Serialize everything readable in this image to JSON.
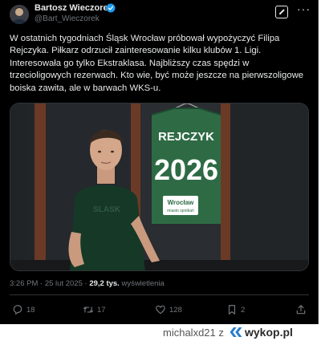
{
  "author": {
    "name": "Bartosz Wieczorek",
    "handle": "@Bart_Wieczorek"
  },
  "tweet": {
    "lines": [
      "W ostatnich tygodniach Śląsk Wrocław próbował wypożyczyć Filipa",
      "Rejczyka. Piłkarz odrzucił zainteresowanie kilku klubów 1. Ligi.",
      "Interesowała go tylko Ekstraklasa. Najbliższy czas spędzi w",
      "trzecioligowych rezerwach. Kto wie, być może jeszcze na pierwszoligowe",
      "boiska zawita, ale w barwach WKS-u."
    ]
  },
  "photo": {
    "jersey_name": "REJCZYK",
    "jersey_number": "2026",
    "sponsor_line1": "Wrocław",
    "sponsor_line2": "miasto spotkań",
    "shirt_print": "SLASK"
  },
  "meta": {
    "time": "3:26 PM",
    "separator": " · ",
    "date": "25 lut 2025",
    "views_count": "29,2 tys.",
    "views_label": "wyświetlenia"
  },
  "actions": {
    "replies": "18",
    "reposts": "17",
    "likes": "128",
    "bookmarks": "2"
  },
  "footer": {
    "username": "michalxd21",
    "z": "z",
    "site": "wykop.pl"
  },
  "colors": {
    "background": "#000000",
    "text": "#e7e9ea",
    "muted": "#71767b",
    "verified": "#1d9bf0",
    "jersey_green": "#2e6b45"
  },
  "icons": [
    "verified-badge-icon",
    "grok-icon",
    "more-icon",
    "reply-icon",
    "repost-icon",
    "like-icon",
    "views-icon",
    "bookmark-icon",
    "share-icon",
    "wykop-logo-icon"
  ]
}
